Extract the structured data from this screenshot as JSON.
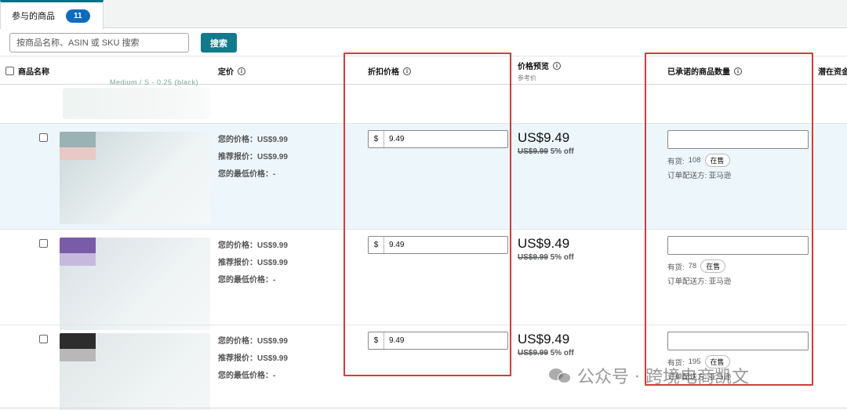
{
  "tabs": [
    {
      "label": "参与的商品",
      "count": "11"
    }
  ],
  "search": {
    "placeholder": "按商品名称、ASIN 或 SKU 搜索",
    "button_label": "搜索"
  },
  "columns": {
    "name": "商品名称",
    "list_price": "定价",
    "discount_price": "折扣价格",
    "price_preview": "价格预览",
    "price_preview_sub": "参考价",
    "committed_units": "已承诺的商品数量",
    "potential": "潜在资金"
  },
  "partial_row_text": "Medium / S - 0.25 (black)",
  "price_labels": {
    "your_price": "您的价格：",
    "recommended": "推荐报价：",
    "lowest": "您的最低价格："
  },
  "rows": [
    {
      "your_price": "US$9.99",
      "recommended": "US$9.99",
      "lowest": "-",
      "currency": "$",
      "discount": "9.49",
      "preview_price": "US$9.49",
      "preview_old": "US$9.99",
      "preview_off": "5% off",
      "stock_label": "有货:",
      "stock_count": "108",
      "stock_status": "在售",
      "ship": "订单配送方: 亚马逊",
      "selected": true,
      "thumb_colors": [
        "#9bb2b4",
        "#e8c9c5",
        "#c9d6d8"
      ]
    },
    {
      "your_price": "US$9.99",
      "recommended": "US$9.99",
      "lowest": "-",
      "currency": "$",
      "discount": "9.49",
      "preview_price": "US$9.49",
      "preview_old": "US$9.99",
      "preview_off": "5% off",
      "stock_label": "有货:",
      "stock_count": "78",
      "stock_status": "在售",
      "ship": "订单配送方: 亚马逊",
      "selected": false,
      "thumb_colors": [
        "#7a5ba8",
        "#c7b8de",
        "#d8dfe4"
      ]
    },
    {
      "your_price": "US$9.99",
      "recommended": "US$9.99",
      "lowest": "-",
      "currency": "$",
      "discount": "9.49",
      "preview_price": "US$9.49",
      "preview_old": "US$9.99",
      "preview_off": "5% off",
      "stock_label": "有货:",
      "stock_count": "195",
      "stock_status": "在售",
      "ship": "订单配送方: 亚马逊",
      "selected": false,
      "thumb_colors": [
        "#2d2d2d",
        "#b8b8b8",
        "#dfe6e6"
      ]
    }
  ],
  "watermark": "公众号 · 跨境电商凯文",
  "colors": {
    "accent": "#117a8b",
    "badge": "#0f6cbd",
    "highlight": "#d63a3a",
    "selected_row": "#edf6fb"
  }
}
